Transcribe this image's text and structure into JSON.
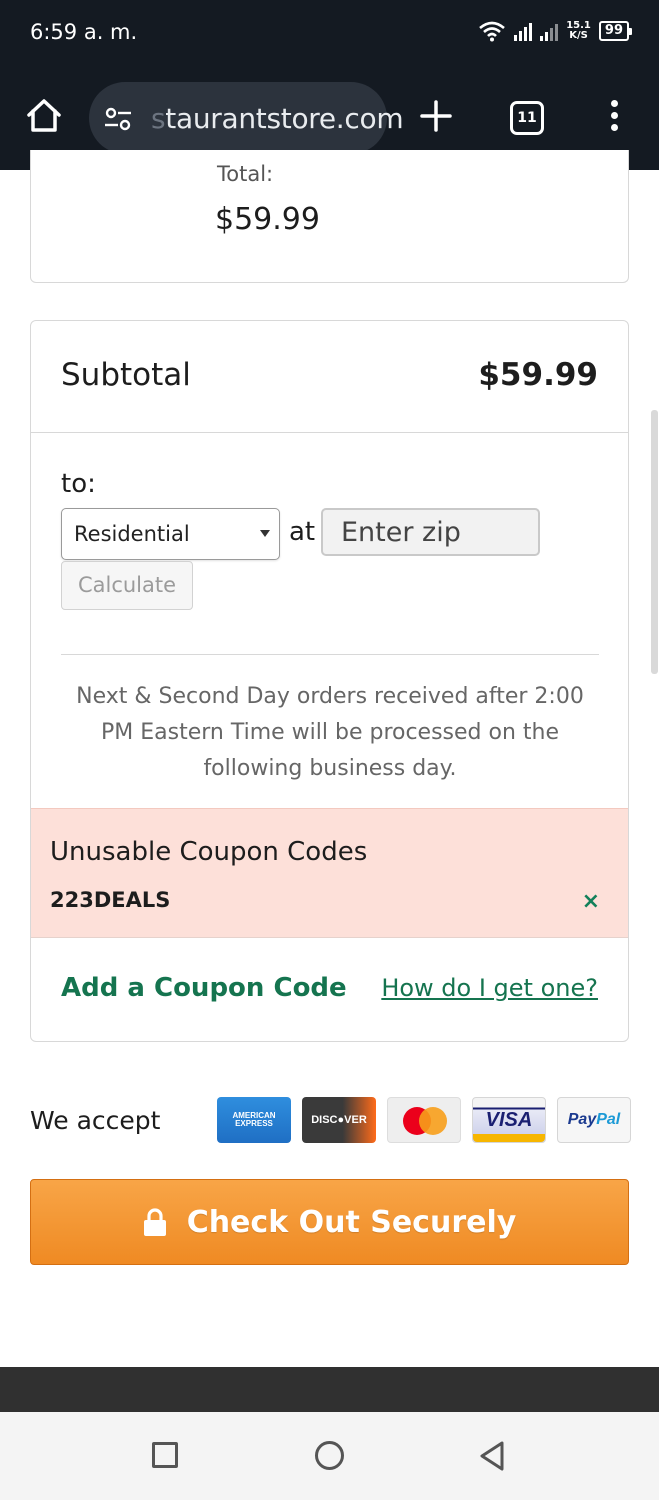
{
  "status_bar": {
    "time": "6:59 a. m.",
    "speed_top": "15.1",
    "speed_bottom": "K/S",
    "battery": "99"
  },
  "browser": {
    "url_faded": "s",
    "url": "taurantstore.com",
    "tab_count": "11"
  },
  "order_summary": {
    "total_label": "Total:",
    "total_value": "$59.99"
  },
  "subtotal": {
    "label": "Subtotal",
    "value": "$59.99"
  },
  "shipping": {
    "to_label": "to:",
    "address_type": "Residential",
    "at_label": "at",
    "zip_placeholder": "Enter zip",
    "calculate_label": "Calculate"
  },
  "notice": "Next & Second Day orders received after 2:00 PM Eastern Time will be processed on the following business day.",
  "coupons": {
    "title": "Unusable Coupon Codes",
    "code": "223DEALS",
    "remove_symbol": "×",
    "add_label": "Add a Coupon Code",
    "help_link": "How do I get one?"
  },
  "payment": {
    "accept_label": "We accept",
    "methods": [
      "AMERICAN EXPRESS",
      "DISCOVER",
      "Mastercard",
      "VISA",
      "PayPal"
    ],
    "checkout_label": "Check Out Securely"
  },
  "colors": {
    "accent_green": "#15744f",
    "checkout_orange": "#f39a33",
    "coupon_bg": "#fde0d9",
    "chrome_bg": "#141a22"
  }
}
